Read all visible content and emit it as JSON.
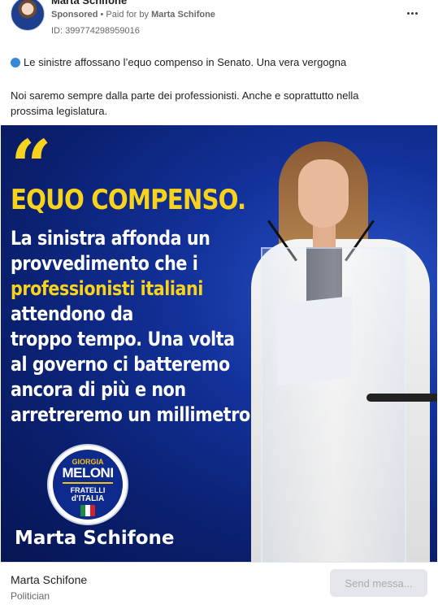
{
  "header": {
    "advertiser": "Marta Schifone",
    "sponsored": "Sponsored",
    "paid_for_prefix": "• Paid for by",
    "paid_for_name": "Marta Schifone",
    "ad_id": "ID: 399774298959016"
  },
  "post": {
    "line1": "Le sinistre affossano l’equo compenso in Senato. Una vera vergogna",
    "line2": "Noi saremo sempre dalla parte dei professionisti. Anche e soprattutto nella prossima legislatura."
  },
  "creative": {
    "quote_mark": "“",
    "headline": "EQUO COMPENSO.",
    "claim": {
      "l1": "La sinistra affonda un",
      "l2": "provvedimento che i",
      "l3_highlight": "professionisti italiani",
      "l4": "attendono da",
      "l5": "troppo tempo. Una volta",
      "l6": "al governo ci batteremo",
      "l7": "ancora di più e non",
      "l8": "arretreremo un millimetro"
    },
    "logo": {
      "leader": "GIORGIA",
      "name": "MELONI",
      "party1": "FRATELLI",
      "party2": "d’ITALIA"
    },
    "candidate_name": "Marta Schifone",
    "colors": {
      "background": "#0a1f6e",
      "accent_yellow": "#f8d31d",
      "text_white": "#ffffff"
    }
  },
  "footer": {
    "page_name": "Marta Schifone",
    "category": "Politician",
    "cta_label": "Send messa..."
  },
  "icons": {
    "more": "more-horizontal-icon",
    "bullet": "blue-circle-emoji"
  }
}
